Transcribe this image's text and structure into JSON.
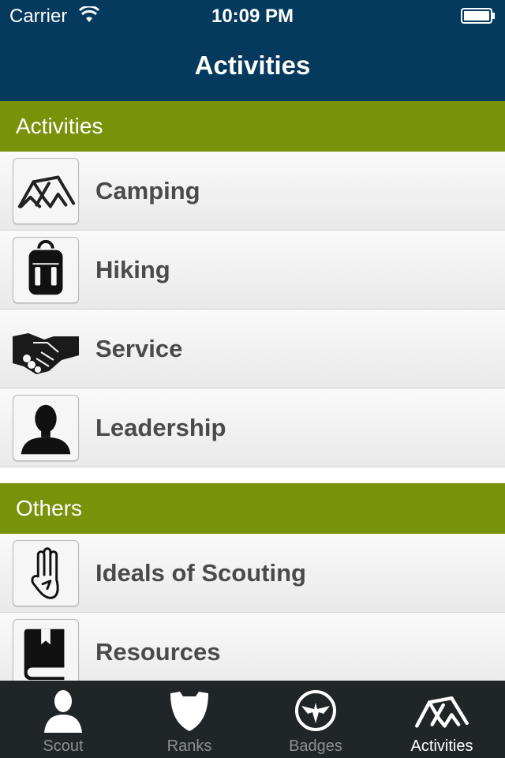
{
  "status_bar": {
    "carrier": "Carrier",
    "time": "10:09 PM"
  },
  "nav": {
    "title": "Activities"
  },
  "sections": [
    {
      "title": "Activities",
      "items": [
        {
          "label": "Camping",
          "icon": "tent-icon"
        },
        {
          "label": "Hiking",
          "icon": "backpack-icon"
        },
        {
          "label": "Service",
          "icon": "handshake-icon"
        },
        {
          "label": "Leadership",
          "icon": "person-silhouette-icon"
        }
      ]
    },
    {
      "title": "Others",
      "items": [
        {
          "label": "Ideals of Scouting",
          "icon": "scout-salute-hand-icon"
        },
        {
          "label": "Resources",
          "icon": "book-icon"
        }
      ]
    }
  ],
  "tab_bar": {
    "tabs": [
      {
        "label": "Scout",
        "icon": "person-icon",
        "active": false
      },
      {
        "label": "Ranks",
        "icon": "shield-icon",
        "active": false
      },
      {
        "label": "Badges",
        "icon": "eagle-emblem-icon",
        "active": false
      },
      {
        "label": "Activities",
        "icon": "tent-icon",
        "active": true
      }
    ]
  },
  "colors": {
    "nav_bar": "#053a5f",
    "section_header": "#78920a",
    "tab_bar": "#202528",
    "row_text": "#4a4a4a"
  }
}
